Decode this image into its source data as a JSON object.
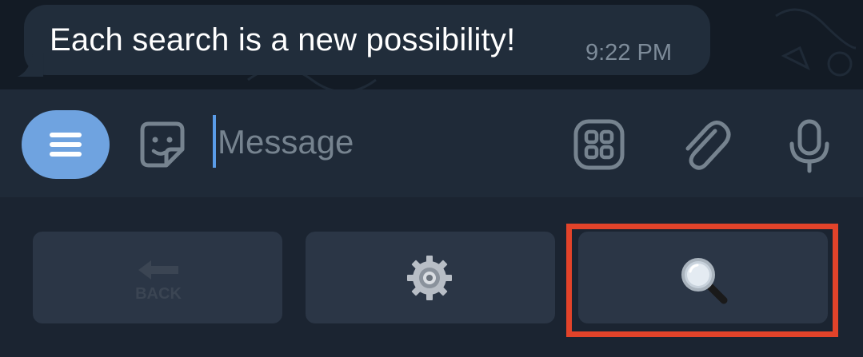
{
  "chat": {
    "message_text": "Each search is a new possibility!",
    "message_time": "9:22 PM"
  },
  "composer": {
    "placeholder": "Message",
    "menu_icon": "menu-icon",
    "sticker_icon": "sticker-icon",
    "app_icon": "app-grid-icon",
    "attach_icon": "paperclip-icon",
    "mic_icon": "microphone-icon"
  },
  "keyboard": {
    "buttons": [
      {
        "label": "BACK",
        "icon": "back-arrow-icon"
      },
      {
        "label": "",
        "icon": "gear-icon"
      },
      {
        "label": "",
        "icon": "magnifier-icon"
      }
    ],
    "highlighted_button": 3
  },
  "colors": {
    "accent": "#6fa3e0",
    "highlight": "#e2432a"
  }
}
